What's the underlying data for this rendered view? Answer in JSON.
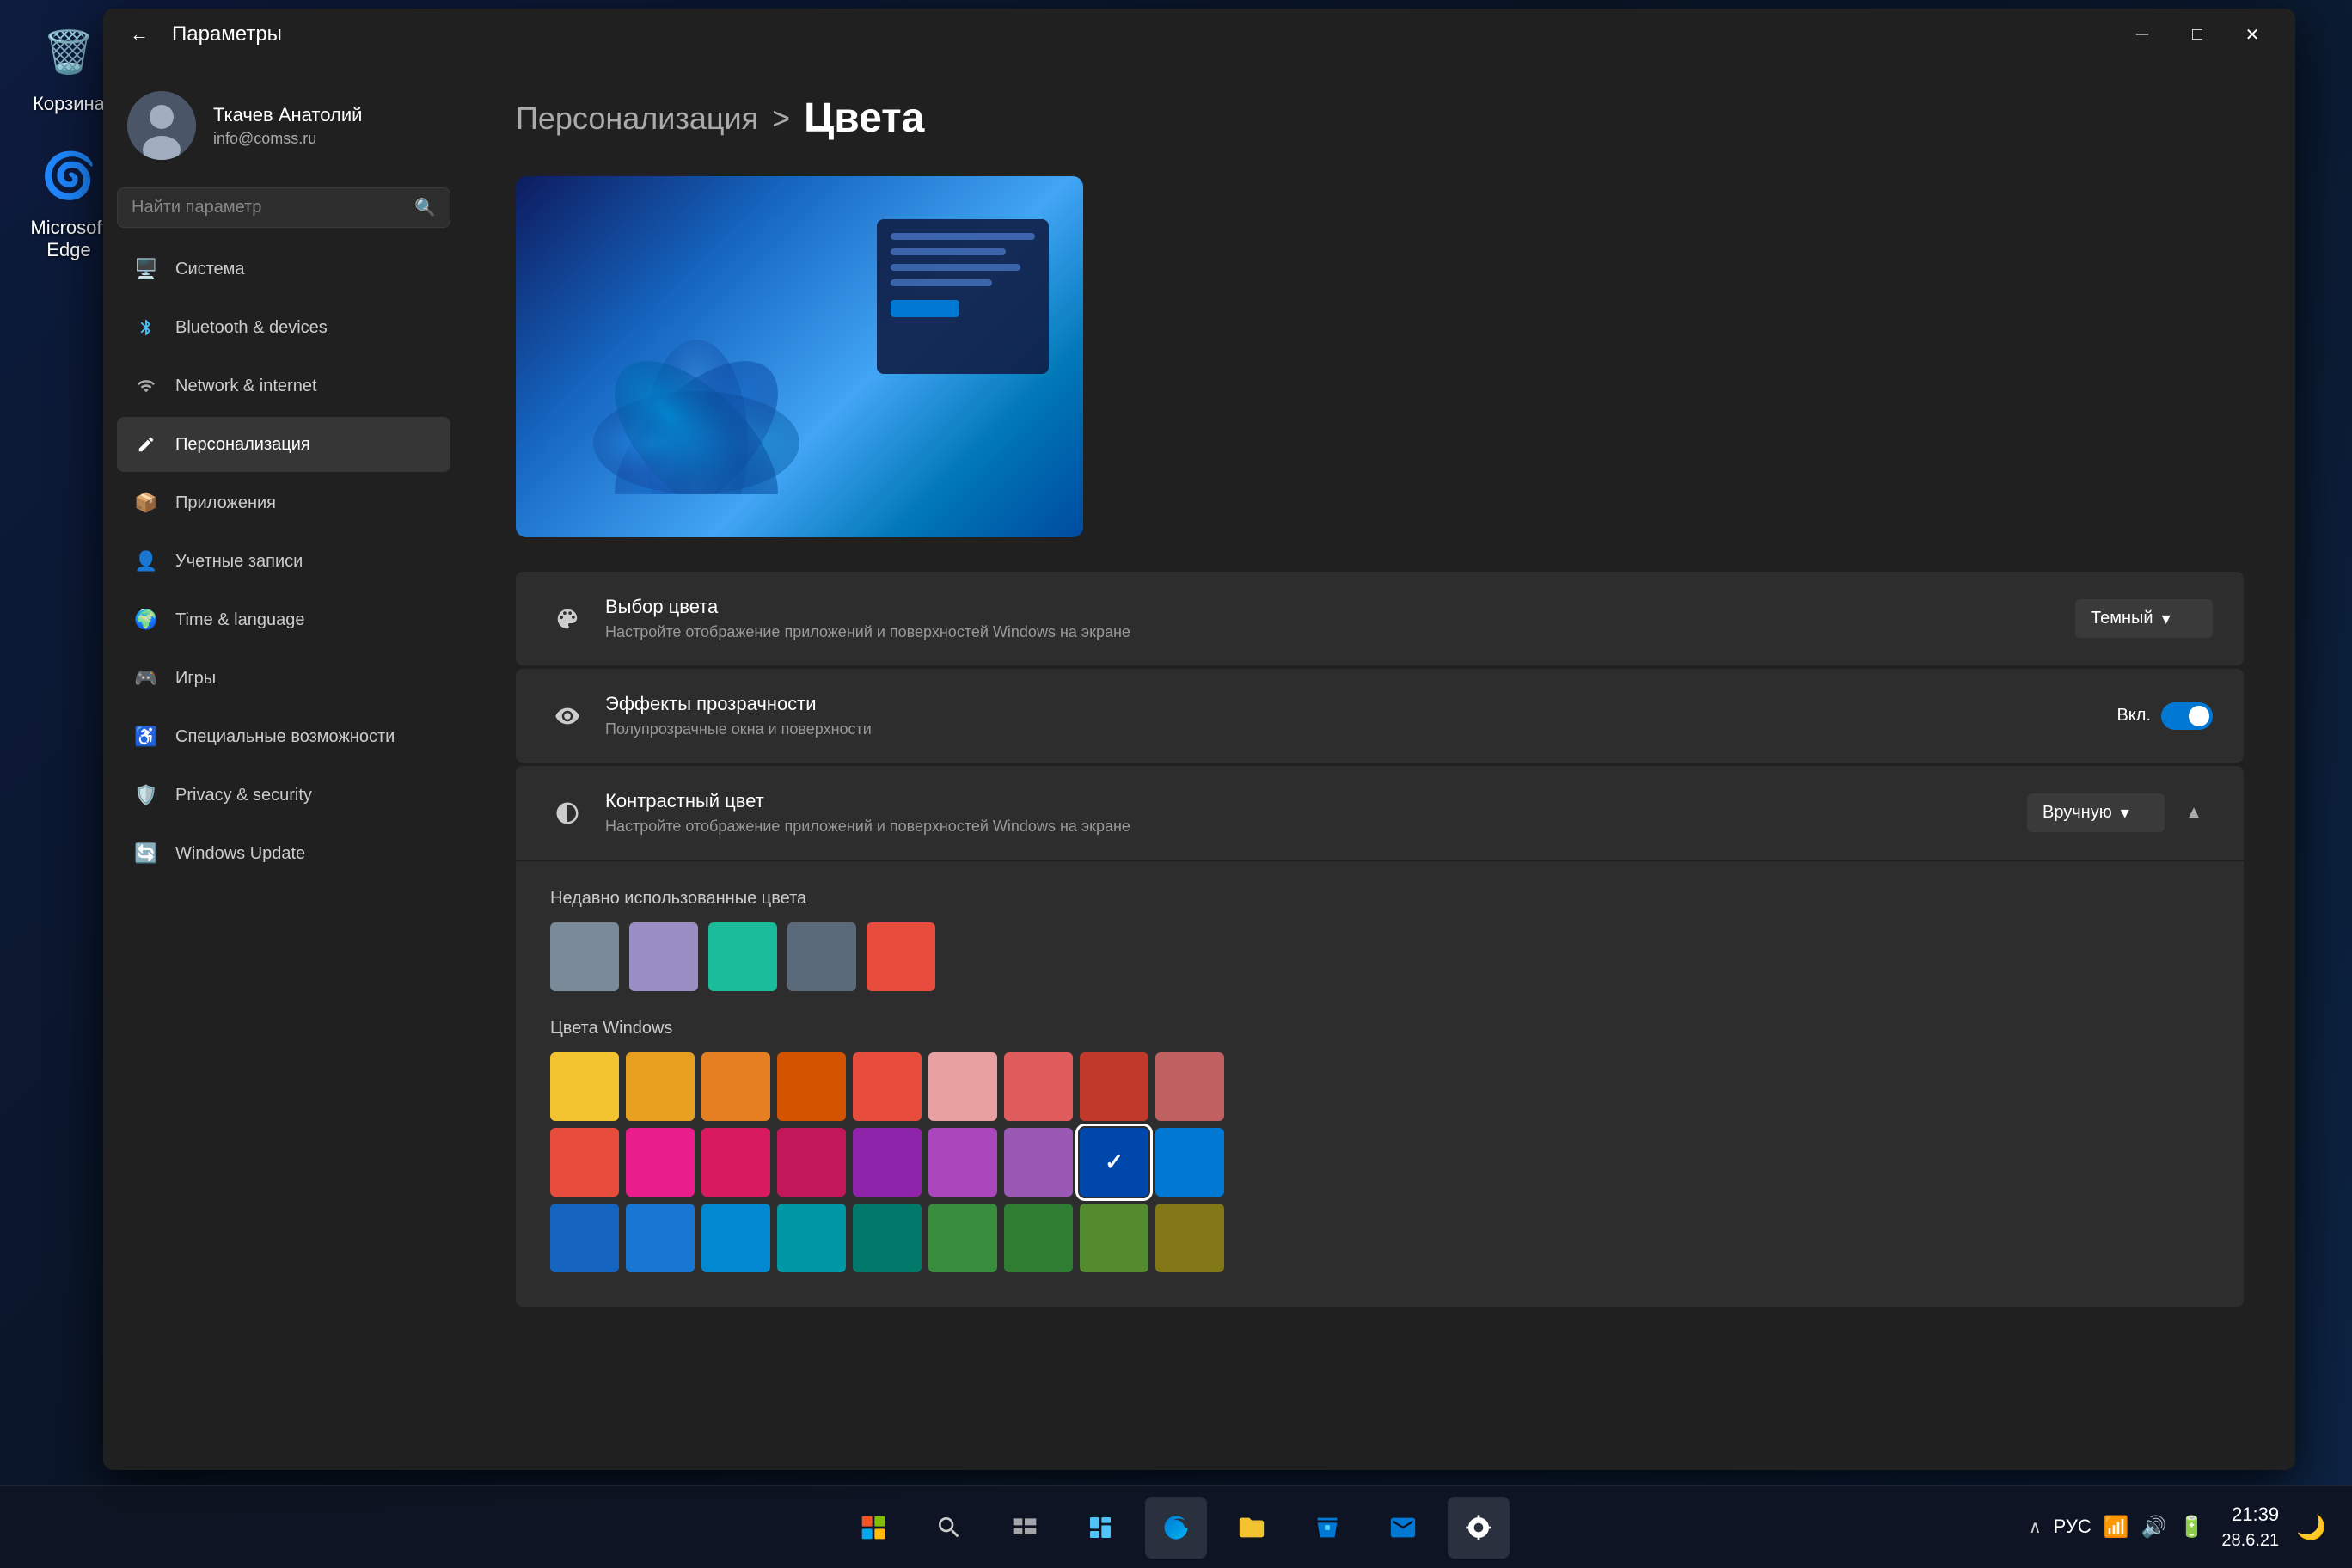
{
  "desktop": {
    "background": "#0a1628",
    "icons": [
      {
        "id": "recycle-bin",
        "emoji": "🗑️",
        "label": "Корзина"
      },
      {
        "id": "microsoft-edge",
        "emoji": "🌐",
        "label": "Microsoft Edge"
      }
    ]
  },
  "taskbar": {
    "center_items": [
      {
        "id": "start",
        "emoji": "⊞",
        "title": "Пуск"
      },
      {
        "id": "search",
        "emoji": "🔍",
        "title": "Поиск"
      },
      {
        "id": "taskview",
        "emoji": "⧉",
        "title": "Представление задач"
      },
      {
        "id": "widgets",
        "emoji": "⊟",
        "title": "Виджеты"
      },
      {
        "id": "edge",
        "emoji": "🌐",
        "title": "Microsoft Edge"
      },
      {
        "id": "explorer",
        "emoji": "📁",
        "title": "Проводник"
      },
      {
        "id": "store",
        "emoji": "🛍️",
        "title": "Microsoft Store"
      },
      {
        "id": "mail",
        "emoji": "✉️",
        "title": "Почта"
      },
      {
        "id": "settings",
        "emoji": "⚙️",
        "title": "Параметры"
      }
    ],
    "systray": {
      "language": "РУС",
      "time": "21:39",
      "date": "28.6.21"
    }
  },
  "window": {
    "title": "Параметры",
    "back_button": "←",
    "controls": {
      "minimize": "─",
      "maximize": "□",
      "close": "✕"
    }
  },
  "user": {
    "name": "Ткачев Анатолий",
    "email": "info@comss.ru",
    "avatar_emoji": "👤"
  },
  "search": {
    "placeholder": "Найти параметр"
  },
  "sidebar": {
    "items": [
      {
        "id": "system",
        "icon": "🖥️",
        "label": "Система"
      },
      {
        "id": "bluetooth",
        "icon": "🔵",
        "label": "Bluetooth & devices"
      },
      {
        "id": "network",
        "icon": "📶",
        "label": "Network & internet"
      },
      {
        "id": "personalization",
        "icon": "✏️",
        "label": "Персонализация",
        "active": true
      },
      {
        "id": "apps",
        "icon": "📦",
        "label": "Приложения"
      },
      {
        "id": "accounts",
        "icon": "👤",
        "label": "Учетные записи"
      },
      {
        "id": "time",
        "icon": "🌍",
        "label": "Time & language"
      },
      {
        "id": "gaming",
        "icon": "🎮",
        "label": "Игры"
      },
      {
        "id": "accessibility",
        "icon": "♿",
        "label": "Специальные возможности"
      },
      {
        "id": "privacy",
        "icon": "🛡️",
        "label": "Privacy & security"
      },
      {
        "id": "windows-update",
        "icon": "🔄",
        "label": "Windows Update"
      }
    ]
  },
  "page": {
    "parent": "Персонализация",
    "separator": ">",
    "title": "Цвета"
  },
  "settings": {
    "color_choice": {
      "icon": "🎨",
      "title": "Выбор цвета",
      "desc": "Настройте отображение приложений и поверхностей Windows на экране",
      "value": "Темный",
      "dropdown_arrow": "▾"
    },
    "transparency": {
      "icon": "🔲",
      "title": "Эффекты прозрачности",
      "desc": "Полупрозрачные окна и поверхности",
      "toggle_label": "Вкл.",
      "toggle_on": true
    },
    "contrast": {
      "icon": "◑",
      "title": "Контрастный цвет",
      "desc": "Настройте отображение приложений и поверхностей Windows на экране",
      "value": "Вручную",
      "dropdown_arrow": "▾",
      "expanded": true,
      "expand_icon_up": "▲",
      "expand_icon_down": "▾"
    }
  },
  "expanded": {
    "recent_label": "Недавно использованные цвета",
    "recent_colors": [
      "#7a8a99",
      "#9b8ec4",
      "#1abc9c",
      "#5a6a7a",
      "#e74c3c"
    ],
    "windows_label": "Цвета Windows",
    "windows_colors": [
      [
        "#f4c430",
        "#e8a020",
        "#e67e22",
        "#d35400",
        "#e74c3c",
        "#e8a0a0",
        "#e05c5c",
        "#c0392b",
        "#c06060"
      ],
      [
        "#e74c3c",
        "#e91e8c",
        "#d81b60",
        "#c2185b",
        "#8e24aa",
        "#ab47bc",
        "#9b59b6",
        "#0047ab",
        "#0078d4"
      ],
      [
        "#1565c0",
        "#1976d2",
        "#0288d1",
        "#0097a7",
        "#00796b",
        "#388e3c",
        "#2e7d32",
        "#558b2f",
        "#827717"
      ]
    ],
    "selected_color": "#0047ab"
  }
}
